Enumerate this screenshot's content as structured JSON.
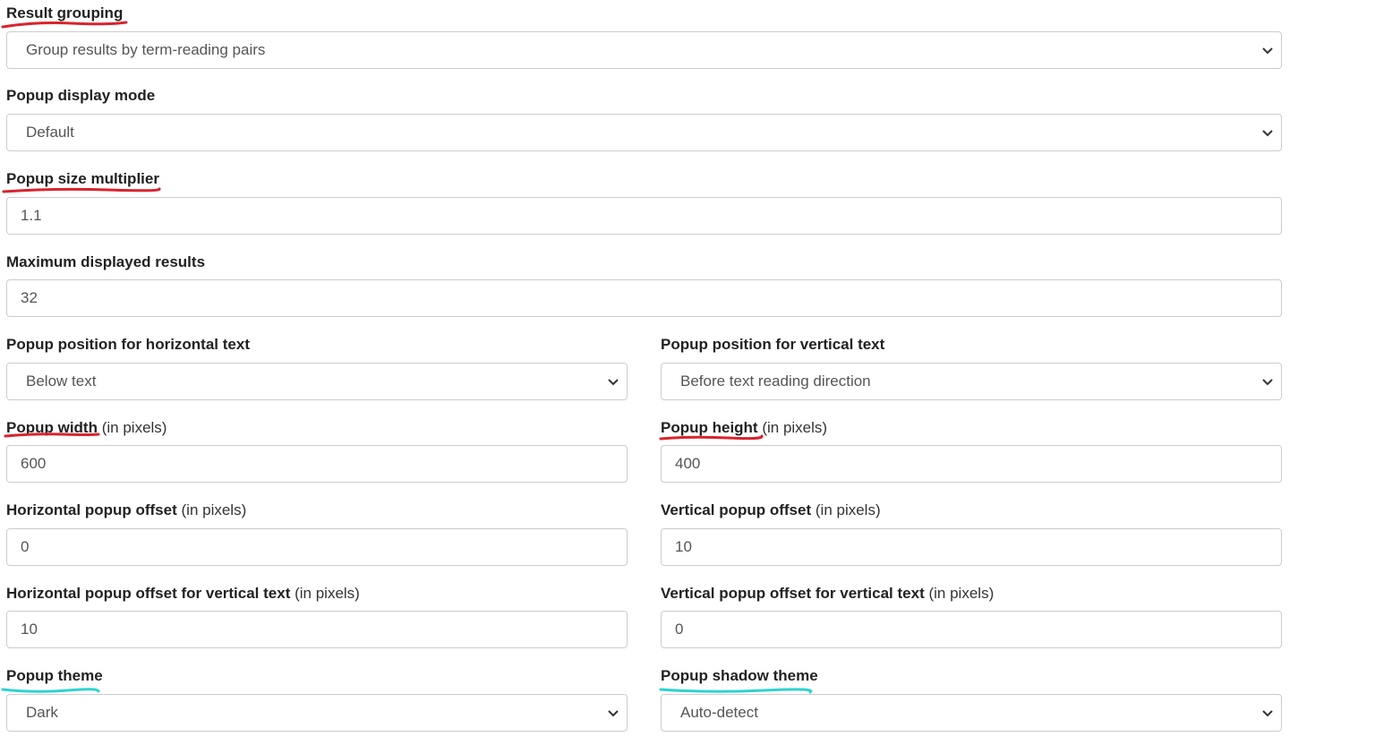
{
  "result_grouping": {
    "label": "Result grouping",
    "value": "Group results by term-reading pairs"
  },
  "popup_display_mode": {
    "label": "Popup display mode",
    "value": "Default"
  },
  "popup_size_multiplier": {
    "label": "Popup size multiplier",
    "value": "1.1"
  },
  "max_displayed_results": {
    "label": "Maximum displayed results",
    "value": "32"
  },
  "popup_position_horizontal": {
    "label": "Popup position for horizontal text",
    "value": "Below text"
  },
  "popup_position_vertical": {
    "label": "Popup position for vertical text",
    "value": "Before text reading direction"
  },
  "popup_width": {
    "label": "Popup width",
    "hint": "(in pixels)",
    "value": "600"
  },
  "popup_height": {
    "label": "Popup height",
    "hint": "(in pixels)",
    "value": "400"
  },
  "horizontal_popup_offset": {
    "label": "Horizontal popup offset",
    "hint": "(in pixels)",
    "value": "0"
  },
  "vertical_popup_offset": {
    "label": "Vertical popup offset",
    "hint": "(in pixels)",
    "value": "10"
  },
  "horizontal_popup_offset_vertical_text": {
    "label": "Horizontal popup offset for vertical text",
    "hint": "(in pixels)",
    "value": "10"
  },
  "vertical_popup_offset_vertical_text": {
    "label": "Vertical popup offset for vertical text",
    "hint": "(in pixels)",
    "value": "0"
  },
  "popup_theme": {
    "label": "Popup theme",
    "value": "Dark"
  },
  "popup_shadow_theme": {
    "label": "Popup shadow theme",
    "value": "Auto-detect"
  },
  "colors": {
    "red_annotation": "#d9232d",
    "cyan_annotation": "#2ed3d0",
    "border": "#cccccc"
  }
}
